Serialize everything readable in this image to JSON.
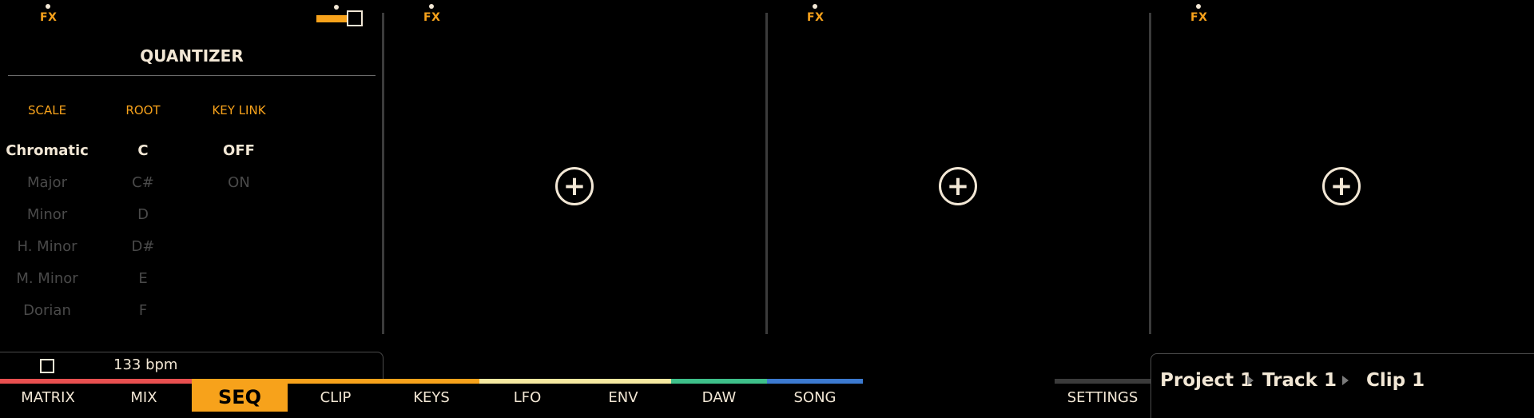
{
  "fx_label": "FX",
  "quantizer": {
    "title": "QUANTIZER",
    "columns": [
      {
        "header": "SCALE",
        "options": [
          "Chromatic",
          "Major",
          "Minor",
          "H. Minor",
          "M. Minor",
          "Dorian"
        ],
        "selected": 0
      },
      {
        "header": "ROOT",
        "options": [
          "C",
          "C#",
          "D",
          "D#",
          "E",
          "F"
        ],
        "selected": 0
      },
      {
        "header": "KEY LINK",
        "options": [
          "OFF",
          "ON"
        ],
        "selected": 0
      }
    ]
  },
  "transport": {
    "bpm": "133 bpm"
  },
  "tabs": [
    "MATRIX",
    "MIX",
    "SEQ",
    "CLIP",
    "KEYS",
    "LFO",
    "ENV",
    "DAW",
    "SONG"
  ],
  "active_tab": "SEQ",
  "settings_label": "SETTINGS",
  "breadcrumb": {
    "project": "Project 1",
    "track": "Track 1",
    "clip": "Clip 1"
  },
  "add_symbol": "+",
  "colors": {
    "accent": "#f7a21b",
    "text": "#f2e7d5",
    "strip": [
      "#e85050",
      "#e85050",
      "#f7a21b",
      "#f7a21b",
      "#f7a21b",
      "#f5e8a0",
      "#f5e8a0",
      "#3ec08a",
      "#3c7ad0"
    ]
  }
}
